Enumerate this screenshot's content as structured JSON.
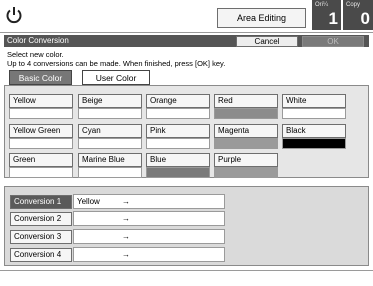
{
  "header": {
    "area_editing_label": "Area Editing",
    "originals_label": "Ori¼",
    "originals_count": "1",
    "copies_label": "Copy",
    "copies_count": "0"
  },
  "dialog": {
    "title": "Color Conversion",
    "cancel_label": "Cancel",
    "ok_label": "OK",
    "instruction_1": "Select new color.",
    "instruction_2": "Up to 4 conversions can be made. When finished, press [OK] key."
  },
  "tabs": [
    {
      "label": "Basic Color",
      "active": true
    },
    {
      "label": "User Color",
      "active": false
    }
  ],
  "colors": [
    {
      "label": "Yellow",
      "swatch": "#ffffff"
    },
    {
      "label": "Beige",
      "swatch": "#ffffff"
    },
    {
      "label": "Orange",
      "swatch": "#ffffff"
    },
    {
      "label": "Red",
      "swatch": "#8c8c8c"
    },
    {
      "label": "White",
      "swatch": "#ffffff"
    },
    {
      "label": "Yellow Green",
      "swatch": "#ffffff"
    },
    {
      "label": "Cyan",
      "swatch": "#ffffff"
    },
    {
      "label": "Pink",
      "swatch": "#ffffff"
    },
    {
      "label": "Magenta",
      "swatch": "#9a9a9a"
    },
    {
      "label": "Black",
      "swatch": "#000000"
    },
    {
      "label": "Green",
      "swatch": "#ffffff"
    },
    {
      "label": "Marine Blue",
      "swatch": "#ffffff"
    },
    {
      "label": "Blue",
      "swatch": "#7a7a7a"
    },
    {
      "label": "Purple",
      "swatch": "#9a9a9a"
    }
  ],
  "conversions": [
    {
      "label": "Conversion 1",
      "from": "Yellow",
      "arrow": "→",
      "active": true
    },
    {
      "label": "Conversion 2",
      "from": "",
      "arrow": "→",
      "active": false
    },
    {
      "label": "Conversion 3",
      "from": "",
      "arrow": "→",
      "active": false
    },
    {
      "label": "Conversion 4",
      "from": "",
      "arrow": "→",
      "active": false
    }
  ]
}
